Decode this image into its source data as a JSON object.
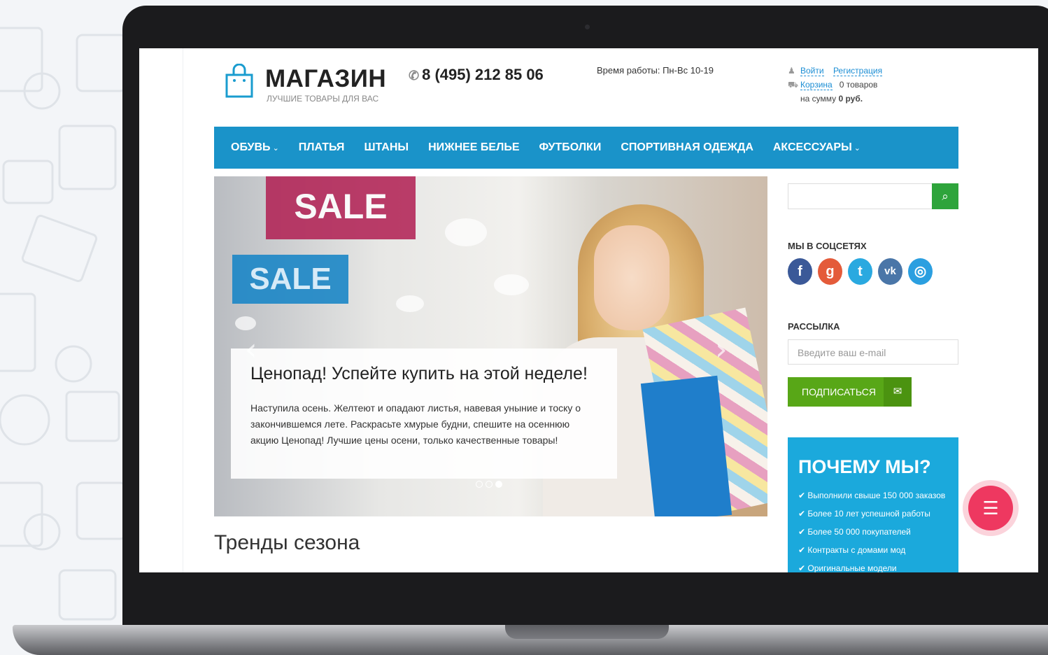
{
  "logo": {
    "name": "МАГАЗИН",
    "tagline": "ЛУЧШИЕ ТОВАРЫ ДЛЯ ВАС"
  },
  "header": {
    "phone": "8 (495) 212 85 06",
    "hours": "Время работы: Пн-Вс 10-19",
    "login": "Войти",
    "register": "Регистрация",
    "cart_label": "Корзина",
    "cart_count": "0 товаров",
    "cart_sum_prefix": "на сумму",
    "cart_sum": "0 руб."
  },
  "nav": [
    "ОБУВЬ",
    "ПЛАТЬЯ",
    "ШТАНЫ",
    "НИЖНЕЕ БЕЛЬЕ",
    "ФУТБОЛКИ",
    "СПОРТИВНАЯ ОДЕЖДА",
    "АКСЕССУАРЫ"
  ],
  "slider": {
    "sign1": "SALE",
    "sign2": "SALE",
    "title": "Ценопад! Успейте купить на этой неделе!",
    "text": "Наступила осень. Желтеют и опадают листья, навевая уныние и тоску о закончившемся лете. Раскрасьте хмурые будни, спешите на осеннюю акцию Ценопад! Лучшие цены осени, только качественные товары!",
    "slides": 3,
    "active_slide": 3
  },
  "section_title": "Тренды сезона",
  "sidebar": {
    "social_title": "МЫ В СОЦСЕТЯХ",
    "social": [
      {
        "icon": "facebook-icon",
        "glyph": "f",
        "color": "#3b5998"
      },
      {
        "icon": "google-plus-icon",
        "glyph": "g",
        "color": "#e45b3a"
      },
      {
        "icon": "twitter-icon",
        "glyph": "t",
        "color": "#2aa9e0"
      },
      {
        "icon": "vk-icon",
        "glyph": "vk",
        "color": "#4a76a8"
      },
      {
        "icon": "instagram-icon",
        "glyph": "◎",
        "color": "#2b9fe0"
      }
    ],
    "newsletter_title": "РАССЫЛКА",
    "email_placeholder": "Введите ваш e-mail",
    "subscribe": "ПОДПИСАТЬСЯ",
    "why_title": "ПОЧЕМУ МЫ?",
    "why": [
      "Выполнили свыше 150 000 заказов",
      "Более 10 лет успешной работы",
      "Более 50 000 покупателей",
      "Контракты с домами мод",
      "Оригинальные модели"
    ]
  },
  "colors": {
    "nav": "#1a93c9",
    "search_button": "#2ea43b",
    "subscribe": "#58a717",
    "why_box": "#1ba9dc",
    "chat_button": "#ee3860"
  }
}
